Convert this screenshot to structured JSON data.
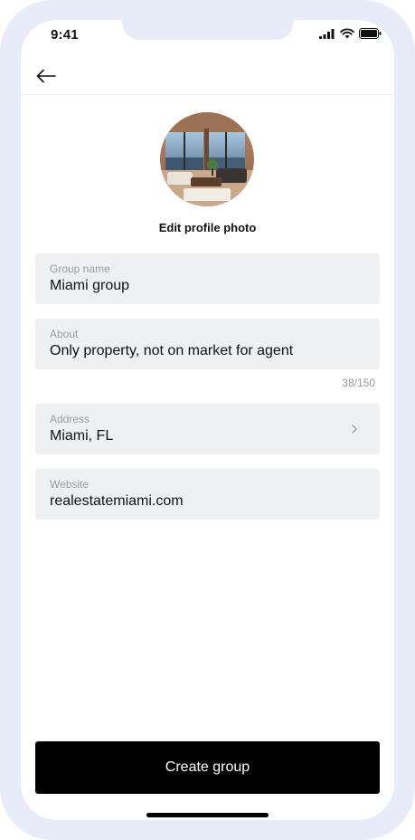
{
  "status_bar": {
    "time": "9:41",
    "icons": [
      "cellular-signal-icon",
      "wifi-icon",
      "battery-icon"
    ]
  },
  "header": {
    "back_icon": "arrow-left-icon"
  },
  "profile": {
    "edit_photo_label": "Edit profile photo"
  },
  "form": {
    "group_name": {
      "label": "Group name",
      "value": "Miami group"
    },
    "about": {
      "label": "About",
      "value": "Only property, not on market for agent",
      "counter": "38/150"
    },
    "address": {
      "label": "Address",
      "value": "Miami, FL",
      "chevron_icon": "chevron-right-icon"
    },
    "website": {
      "label": "Website",
      "value": "realestatemiami.com"
    }
  },
  "footer": {
    "create_button_label": "Create group"
  },
  "colors": {
    "frame": "#e8ebf8",
    "field_bg": "#eff0f2",
    "label_gray": "#9a9ca3",
    "button_bg": "#000000",
    "button_text": "#ffffff"
  }
}
